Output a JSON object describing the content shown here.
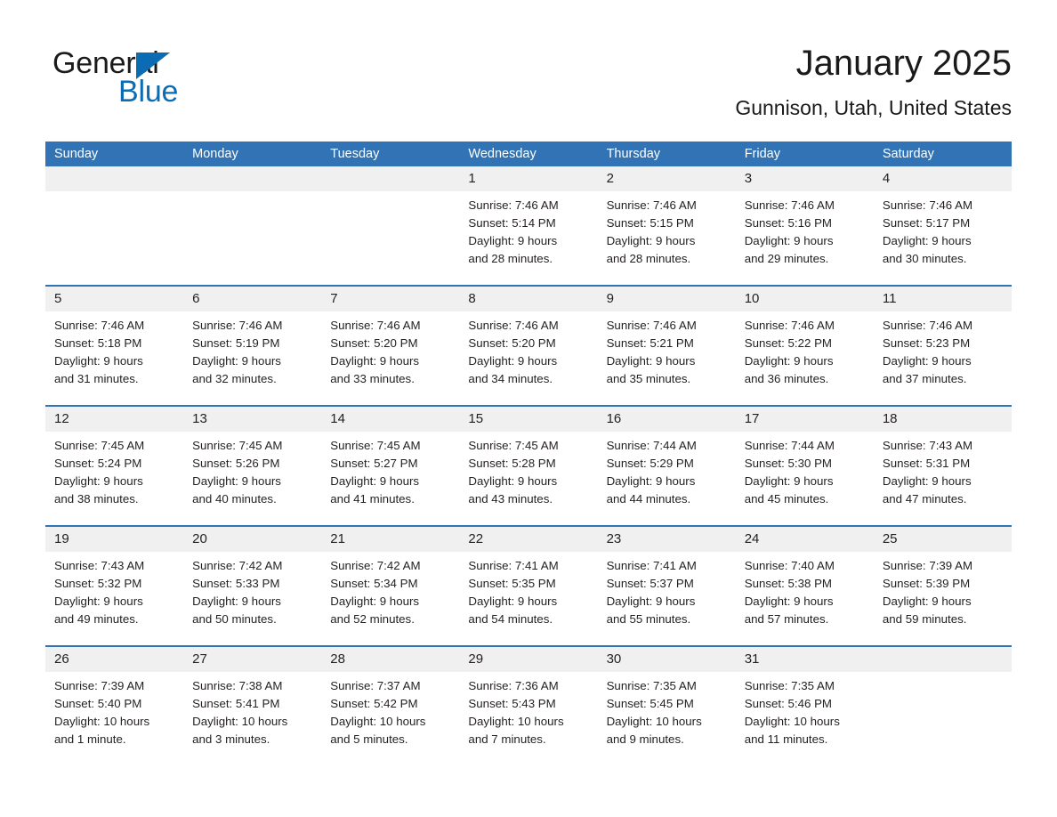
{
  "logo": {
    "word_one": "General",
    "word_two": "Blue",
    "triangle_color": "#0b6cb3"
  },
  "header": {
    "title": "January 2025",
    "location": "Gunnison, Utah, United States"
  },
  "theme": {
    "header_blue": "#3173b4",
    "day_band_gray": "#f0f0f0",
    "text": "#231f20"
  },
  "calendar": {
    "weekdays": [
      "Sunday",
      "Monday",
      "Tuesday",
      "Wednesday",
      "Thursday",
      "Friday",
      "Saturday"
    ],
    "weeks": [
      [
        {
          "day": "",
          "sunrise": "",
          "sunset": "",
          "daylight_line1": "",
          "daylight_line2": ""
        },
        {
          "day": "",
          "sunrise": "",
          "sunset": "",
          "daylight_line1": "",
          "daylight_line2": ""
        },
        {
          "day": "",
          "sunrise": "",
          "sunset": "",
          "daylight_line1": "",
          "daylight_line2": ""
        },
        {
          "day": "1",
          "sunrise": "Sunrise: 7:46 AM",
          "sunset": "Sunset: 5:14 PM",
          "daylight_line1": "Daylight: 9 hours",
          "daylight_line2": "and 28 minutes."
        },
        {
          "day": "2",
          "sunrise": "Sunrise: 7:46 AM",
          "sunset": "Sunset: 5:15 PM",
          "daylight_line1": "Daylight: 9 hours",
          "daylight_line2": "and 28 minutes."
        },
        {
          "day": "3",
          "sunrise": "Sunrise: 7:46 AM",
          "sunset": "Sunset: 5:16 PM",
          "daylight_line1": "Daylight: 9 hours",
          "daylight_line2": "and 29 minutes."
        },
        {
          "day": "4",
          "sunrise": "Sunrise: 7:46 AM",
          "sunset": "Sunset: 5:17 PM",
          "daylight_line1": "Daylight: 9 hours",
          "daylight_line2": "and 30 minutes."
        }
      ],
      [
        {
          "day": "5",
          "sunrise": "Sunrise: 7:46 AM",
          "sunset": "Sunset: 5:18 PM",
          "daylight_line1": "Daylight: 9 hours",
          "daylight_line2": "and 31 minutes."
        },
        {
          "day": "6",
          "sunrise": "Sunrise: 7:46 AM",
          "sunset": "Sunset: 5:19 PM",
          "daylight_line1": "Daylight: 9 hours",
          "daylight_line2": "and 32 minutes."
        },
        {
          "day": "7",
          "sunrise": "Sunrise: 7:46 AM",
          "sunset": "Sunset: 5:20 PM",
          "daylight_line1": "Daylight: 9 hours",
          "daylight_line2": "and 33 minutes."
        },
        {
          "day": "8",
          "sunrise": "Sunrise: 7:46 AM",
          "sunset": "Sunset: 5:20 PM",
          "daylight_line1": "Daylight: 9 hours",
          "daylight_line2": "and 34 minutes."
        },
        {
          "day": "9",
          "sunrise": "Sunrise: 7:46 AM",
          "sunset": "Sunset: 5:21 PM",
          "daylight_line1": "Daylight: 9 hours",
          "daylight_line2": "and 35 minutes."
        },
        {
          "day": "10",
          "sunrise": "Sunrise: 7:46 AM",
          "sunset": "Sunset: 5:22 PM",
          "daylight_line1": "Daylight: 9 hours",
          "daylight_line2": "and 36 minutes."
        },
        {
          "day": "11",
          "sunrise": "Sunrise: 7:46 AM",
          "sunset": "Sunset: 5:23 PM",
          "daylight_line1": "Daylight: 9 hours",
          "daylight_line2": "and 37 minutes."
        }
      ],
      [
        {
          "day": "12",
          "sunrise": "Sunrise: 7:45 AM",
          "sunset": "Sunset: 5:24 PM",
          "daylight_line1": "Daylight: 9 hours",
          "daylight_line2": "and 38 minutes."
        },
        {
          "day": "13",
          "sunrise": "Sunrise: 7:45 AM",
          "sunset": "Sunset: 5:26 PM",
          "daylight_line1": "Daylight: 9 hours",
          "daylight_line2": "and 40 minutes."
        },
        {
          "day": "14",
          "sunrise": "Sunrise: 7:45 AM",
          "sunset": "Sunset: 5:27 PM",
          "daylight_line1": "Daylight: 9 hours",
          "daylight_line2": "and 41 minutes."
        },
        {
          "day": "15",
          "sunrise": "Sunrise: 7:45 AM",
          "sunset": "Sunset: 5:28 PM",
          "daylight_line1": "Daylight: 9 hours",
          "daylight_line2": "and 43 minutes."
        },
        {
          "day": "16",
          "sunrise": "Sunrise: 7:44 AM",
          "sunset": "Sunset: 5:29 PM",
          "daylight_line1": "Daylight: 9 hours",
          "daylight_line2": "and 44 minutes."
        },
        {
          "day": "17",
          "sunrise": "Sunrise: 7:44 AM",
          "sunset": "Sunset: 5:30 PM",
          "daylight_line1": "Daylight: 9 hours",
          "daylight_line2": "and 45 minutes."
        },
        {
          "day": "18",
          "sunrise": "Sunrise: 7:43 AM",
          "sunset": "Sunset: 5:31 PM",
          "daylight_line1": "Daylight: 9 hours",
          "daylight_line2": "and 47 minutes."
        }
      ],
      [
        {
          "day": "19",
          "sunrise": "Sunrise: 7:43 AM",
          "sunset": "Sunset: 5:32 PM",
          "daylight_line1": "Daylight: 9 hours",
          "daylight_line2": "and 49 minutes."
        },
        {
          "day": "20",
          "sunrise": "Sunrise: 7:42 AM",
          "sunset": "Sunset: 5:33 PM",
          "daylight_line1": "Daylight: 9 hours",
          "daylight_line2": "and 50 minutes."
        },
        {
          "day": "21",
          "sunrise": "Sunrise: 7:42 AM",
          "sunset": "Sunset: 5:34 PM",
          "daylight_line1": "Daylight: 9 hours",
          "daylight_line2": "and 52 minutes."
        },
        {
          "day": "22",
          "sunrise": "Sunrise: 7:41 AM",
          "sunset": "Sunset: 5:35 PM",
          "daylight_line1": "Daylight: 9 hours",
          "daylight_line2": "and 54 minutes."
        },
        {
          "day": "23",
          "sunrise": "Sunrise: 7:41 AM",
          "sunset": "Sunset: 5:37 PM",
          "daylight_line1": "Daylight: 9 hours",
          "daylight_line2": "and 55 minutes."
        },
        {
          "day": "24",
          "sunrise": "Sunrise: 7:40 AM",
          "sunset": "Sunset: 5:38 PM",
          "daylight_line1": "Daylight: 9 hours",
          "daylight_line2": "and 57 minutes."
        },
        {
          "day": "25",
          "sunrise": "Sunrise: 7:39 AM",
          "sunset": "Sunset: 5:39 PM",
          "daylight_line1": "Daylight: 9 hours",
          "daylight_line2": "and 59 minutes."
        }
      ],
      [
        {
          "day": "26",
          "sunrise": "Sunrise: 7:39 AM",
          "sunset": "Sunset: 5:40 PM",
          "daylight_line1": "Daylight: 10 hours",
          "daylight_line2": "and 1 minute."
        },
        {
          "day": "27",
          "sunrise": "Sunrise: 7:38 AM",
          "sunset": "Sunset: 5:41 PM",
          "daylight_line1": "Daylight: 10 hours",
          "daylight_line2": "and 3 minutes."
        },
        {
          "day": "28",
          "sunrise": "Sunrise: 7:37 AM",
          "sunset": "Sunset: 5:42 PM",
          "daylight_line1": "Daylight: 10 hours",
          "daylight_line2": "and 5 minutes."
        },
        {
          "day": "29",
          "sunrise": "Sunrise: 7:36 AM",
          "sunset": "Sunset: 5:43 PM",
          "daylight_line1": "Daylight: 10 hours",
          "daylight_line2": "and 7 minutes."
        },
        {
          "day": "30",
          "sunrise": "Sunrise: 7:35 AM",
          "sunset": "Sunset: 5:45 PM",
          "daylight_line1": "Daylight: 10 hours",
          "daylight_line2": "and 9 minutes."
        },
        {
          "day": "31",
          "sunrise": "Sunrise: 7:35 AM",
          "sunset": "Sunset: 5:46 PM",
          "daylight_line1": "Daylight: 10 hours",
          "daylight_line2": "and 11 minutes."
        },
        {
          "day": "",
          "sunrise": "",
          "sunset": "",
          "daylight_line1": "",
          "daylight_line2": ""
        }
      ]
    ]
  }
}
